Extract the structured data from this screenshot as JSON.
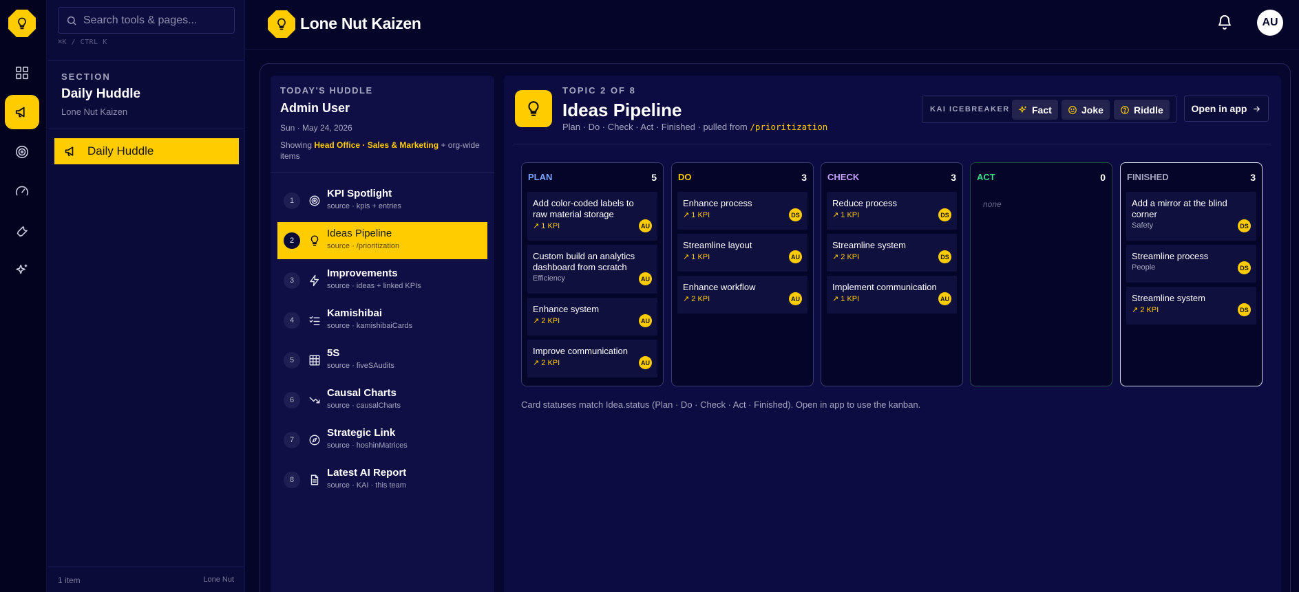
{
  "app": {
    "brand": "Lone Nut Kaizen"
  },
  "search": {
    "placeholder": "Search tools & pages...",
    "shortcut": "⌘K / CTRL K"
  },
  "nav": {
    "section_label": "SECTION",
    "section_title": "Daily Huddle",
    "section_sub": "Lone Nut Kaizen",
    "active_item": "Daily Huddle",
    "footer_count": "1 item",
    "footer_brand": "Lone Nut"
  },
  "rail": {
    "items": [
      "dashboard-icon",
      "megaphone-icon",
      "target-icon",
      "gauge-icon",
      "wrench-icon",
      "sparkles-icon"
    ],
    "active_index": 1
  },
  "header": {
    "avatar": "AU"
  },
  "huddle": {
    "label": "TODAY'S HUDDLE",
    "user": "Admin User",
    "date": "Sun · May 24, 2026",
    "showing_prefix": "Showing",
    "showing_highlight": "Head Office · Sales & Marketing",
    "showing_suffix": "+ org-wide items",
    "topics": [
      {
        "num": "1",
        "name": "KPI Spotlight",
        "source": "source · kpis + entries",
        "icon": "target-icon"
      },
      {
        "num": "2",
        "name": "Ideas Pipeline",
        "source": "source · /prioritization",
        "icon": "lightbulb-icon"
      },
      {
        "num": "3",
        "name": "Improvements",
        "source": "source · ideas + linked KPIs",
        "icon": "bolt-icon"
      },
      {
        "num": "4",
        "name": "Kamishibai",
        "source": "source · kamishibaiCards",
        "icon": "checklist-icon"
      },
      {
        "num": "5",
        "name": "5S",
        "source": "source · fiveSAudits",
        "icon": "grid-icon"
      },
      {
        "num": "6",
        "name": "Causal Charts",
        "source": "source · causalCharts",
        "icon": "trend-down-icon"
      },
      {
        "num": "7",
        "name": "Strategic Link",
        "source": "source · hoshinMatrices",
        "icon": "compass-icon"
      },
      {
        "num": "8",
        "name": "Latest AI Report",
        "source": "source · KAI · this team",
        "icon": "document-icon"
      }
    ],
    "active_index": 1
  },
  "content": {
    "kicker": "TOPIC 2 OF 8",
    "title": "Ideas Pipeline",
    "meta_prefix": "Plan · Do · Check · Act · Finished · pulled from",
    "meta_path": "/prioritization",
    "icebreaker_label": "KAI ICEBREAKER",
    "icebreaker_buttons": [
      "Fact",
      "Joke",
      "Riddle"
    ],
    "open_app": "Open in app",
    "footnote": "Card statuses match Idea.status (Plan · Do · Check · Act · Finished). Open in app to use the kanban."
  },
  "columns": [
    {
      "title": "PLAN",
      "count": "5",
      "color": "#7aa2ff",
      "cards": [
        {
          "title": "Add color-coded labels to raw material storage",
          "meta": "↗ 1 KPI",
          "avatar": "AU"
        },
        {
          "title": "Custom build an analytics dashboard from scratch",
          "category": "Efficiency",
          "avatar": "AU"
        },
        {
          "title": "Enhance system",
          "meta": "↗ 2 KPI",
          "avatar": "AU"
        },
        {
          "title": "Improve communication",
          "meta": "↗ 2 KPI",
          "avatar": "AU"
        }
      ]
    },
    {
      "title": "DO",
      "count": "3",
      "color": "#ffcc00",
      "cards": [
        {
          "title": "Enhance process",
          "meta": "↗ 1 KPI",
          "avatar": "DS"
        },
        {
          "title": "Streamline layout",
          "meta": "↗ 1 KPI",
          "avatar": "AU"
        },
        {
          "title": "Enhance workflow",
          "meta": "↗ 2 KPI",
          "avatar": "AU"
        }
      ]
    },
    {
      "title": "CHECK",
      "count": "3",
      "color": "#c7a2ff",
      "cards": [
        {
          "title": "Reduce process",
          "meta": "↗ 1 KPI",
          "avatar": "DS"
        },
        {
          "title": "Streamline system",
          "meta": "↗ 2 KPI",
          "avatar": "DS"
        },
        {
          "title": "Implement communication",
          "meta": "↗ 1 KPI",
          "avatar": "AU"
        }
      ]
    },
    {
      "title": "ACT",
      "count": "0",
      "color": "#3ddc84",
      "empty": "none",
      "cards": []
    },
    {
      "title": "FINISHED",
      "count": "3",
      "color": "#a6a6c0",
      "cards": [
        {
          "title": "Add a mirror at the blind corner",
          "category": "Safety",
          "avatar": "DS"
        },
        {
          "title": "Streamline process",
          "category": "People",
          "avatar": "DS"
        },
        {
          "title": "Streamline system",
          "meta": "↗ 2 KPI",
          "avatar": "DS"
        }
      ]
    }
  ]
}
